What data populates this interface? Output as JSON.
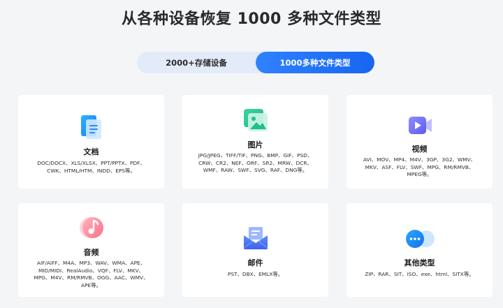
{
  "title": "从各种设备恢复 1000 多种文件类型",
  "tabs": [
    {
      "label": "2000+存储设备",
      "active": false
    },
    {
      "label": "1000多种文件类型",
      "active": true
    }
  ],
  "cards": [
    {
      "name": "文档",
      "icon": "document-icon",
      "desc": "DOC/DOCX、XLS/XLSX、PPT/PPTX、PDF、CWK、HTML/HTM、INDD、EPS等。"
    },
    {
      "name": "图片",
      "icon": "image-icon",
      "desc": "JPG/JPEG、TIFF/TIF、PNG、BMP、GIF、PSD、CRW、CR2、NEF、ORF、SR2、MRW、DCR、WMF、RAW、SWF、SVG、RAF、DNG等。"
    },
    {
      "name": "视频",
      "icon": "video-icon",
      "desc": "AVI、MOV、MP4、M4V、3GP、3G2、WMV、MKV、ASF、FLV、SWF、MPG、RM/RMVB、MPEG等。"
    },
    {
      "name": "音频",
      "icon": "music-note-icon",
      "desc": "AIF/AIFF、M4A、MP3、WAV、WMA、APE、MID/MIDI、RealAudio、VQF、FLV、MKV、MPG、M4V、RM/RMVB、OGG、AAC、WMV、APE等。"
    },
    {
      "name": "邮件",
      "icon": "mail-icon",
      "desc": "PST、DBX、EMLX等。"
    },
    {
      "name": "其他类型",
      "icon": "more-icon",
      "desc": "ZIP、RAR、SIT、ISO、exe、html、SITX等。"
    }
  ],
  "colors": {
    "accent": "#1f6ff5",
    "tab_bg": "#e3ebf9",
    "page_bg": "#f4f5f7"
  }
}
